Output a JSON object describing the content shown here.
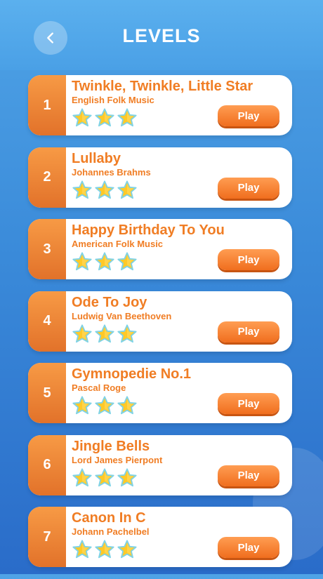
{
  "header": {
    "title": "LEVELS",
    "back_icon": "chevron-left-icon"
  },
  "levels": [
    {
      "number": "1",
      "title": "Twinkle, Twinkle, Little Star",
      "composer": "English Folk Music",
      "stars": 3,
      "play_label": "Play"
    },
    {
      "number": "2",
      "title": "Lullaby",
      "composer": "Johannes Brahms",
      "stars": 3,
      "play_label": "Play"
    },
    {
      "number": "3",
      "title": "Happy Birthday To You",
      "composer": "American Folk Music",
      "stars": 3,
      "play_label": "Play"
    },
    {
      "number": "4",
      "title": "Ode To Joy",
      "composer": "Ludwig Van Beethoven",
      "stars": 3,
      "play_label": "Play"
    },
    {
      "number": "5",
      "title": "Gymnopedie No.1",
      "composer": "Pascal Roge",
      "stars": 3,
      "play_label": "Play"
    },
    {
      "number": "6",
      "title": "Jingle Bells",
      "composer": "Lord James Pierpont",
      "stars": 3,
      "play_label": "Play"
    },
    {
      "number": "7",
      "title": "Canon In C",
      "composer": "Johann Pachelbel",
      "stars": 3,
      "play_label": "Play"
    }
  ],
  "colors": {
    "accent": "#f07d24",
    "background": "#3a8ad9",
    "star": "#ffc928"
  }
}
